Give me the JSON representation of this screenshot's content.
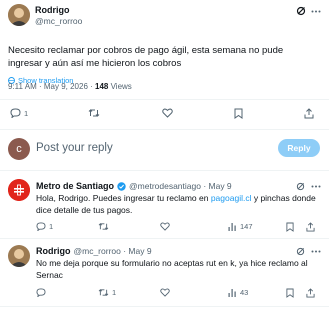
{
  "tweet": {
    "author_name": "Rodrigo",
    "author_handle": "@mc_rorroo",
    "text": "Necesito reclamar por cobros de pago ágil, esta semana no pude ingresar y aún así me hicieron los cobros",
    "show_translation": "Show translation",
    "timestamp": "9:11 AM · May 9, 2026 · ",
    "views_count": "148",
    "views_label": " Views",
    "reply_count": "1"
  },
  "composer": {
    "avatar_letter": "c",
    "placeholder": "Post your reply",
    "reply_button": "Reply"
  },
  "replies": [
    {
      "author_name": "Metro de Santiago",
      "author_handle": "@metrodesantiago · May 9",
      "text_before": "Hola, Rodrigo. Puedes ingresar tu reclamo en ",
      "link": "pagoagil.cl",
      "text_after": " y pinchas donde dice detalle de tus pagos.",
      "reply_count": "1",
      "views": "147"
    },
    {
      "author_name": "Rodrigo",
      "author_handle": "@mc_rorroo · May 9",
      "text": "No me deja porque su formulario no aceptas rut en k, ya hice reclamo al Sernac",
      "retweet_count": "1",
      "views": "43"
    }
  ],
  "colors": {
    "accent": "#1d9bf0",
    "metro_red": "#e1251b",
    "verified": "#1d9bf0"
  }
}
